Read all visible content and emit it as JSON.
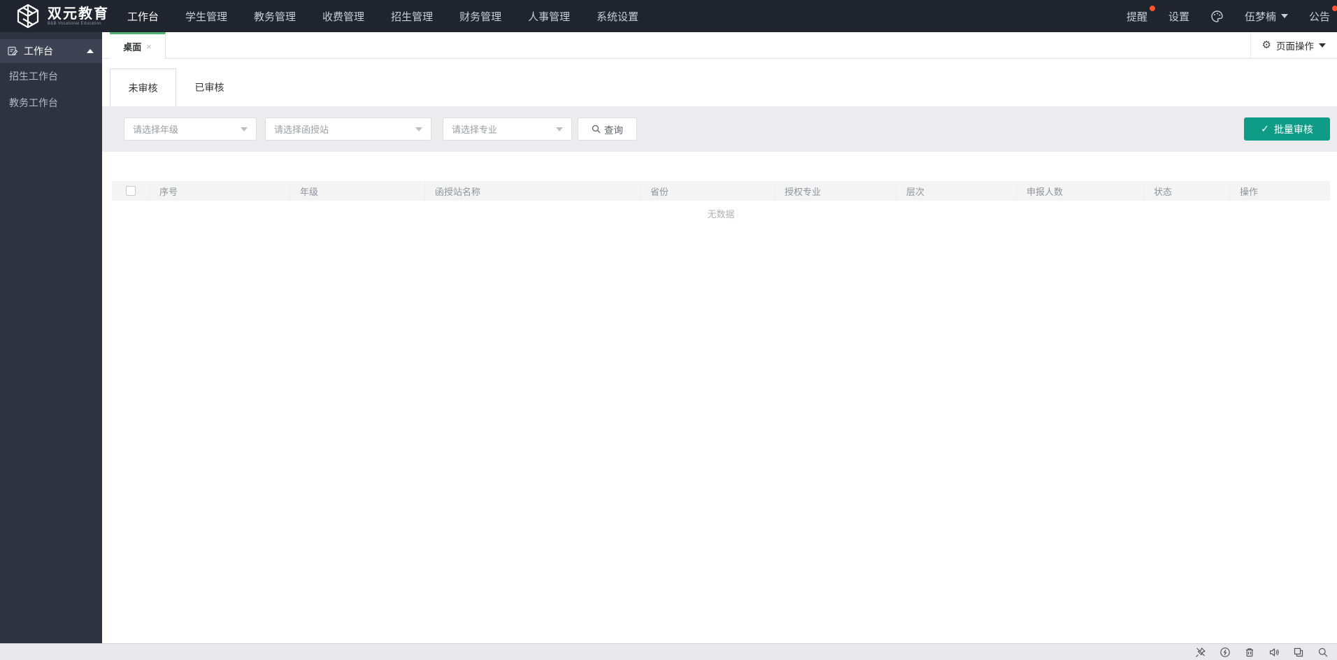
{
  "colors": {
    "accent_green": "#51b371",
    "teal_button": "#0e9c86",
    "badge_red": "#ff522e",
    "navbar_bg": "#20242e",
    "sidebar_bg": "#2e3340"
  },
  "navbar": {
    "brand": {
      "name": "双元教育",
      "subtitle": "B&B Vocational Education"
    },
    "menu": [
      {
        "label": "工作台",
        "active": true
      },
      {
        "label": "学生管理",
        "active": false
      },
      {
        "label": "教务管理",
        "active": false
      },
      {
        "label": "收费管理",
        "active": false
      },
      {
        "label": "招生管理",
        "active": false
      },
      {
        "label": "财务管理",
        "active": false
      },
      {
        "label": "人事管理",
        "active": false
      },
      {
        "label": "系统设置",
        "active": false
      }
    ],
    "right": {
      "notice": "提醒",
      "settings": "设置",
      "user": "伍梦楠",
      "announcement": "公告"
    }
  },
  "sidebar": {
    "header": "工作台",
    "items": [
      {
        "label": "招生工作台"
      },
      {
        "label": "教务工作台"
      }
    ]
  },
  "tabbar": {
    "tabs": [
      {
        "label": "桌面",
        "close": "×"
      }
    ],
    "page_ops": "页面操作"
  },
  "content": {
    "subtabs": [
      {
        "label": "未审核",
        "active": true
      },
      {
        "label": "已审核",
        "active": false
      }
    ],
    "filters": {
      "selects": [
        {
          "placeholder": "请选择年级"
        },
        {
          "placeholder": "请选择函授站"
        },
        {
          "placeholder": "请选择专业"
        }
      ],
      "query": "查询",
      "batch_audit": "批量审核",
      "batch_check": "✓"
    },
    "table": {
      "headers": [
        "序号",
        "年级",
        "函授站名称",
        "省份",
        "授权专业",
        "层次",
        "申报人数",
        "状态",
        "操作"
      ],
      "rows": [],
      "empty": "无数据"
    }
  },
  "taskbar": {
    "icons": [
      "pin-off",
      "speed-circle",
      "trash",
      "volume",
      "window",
      "search"
    ]
  }
}
